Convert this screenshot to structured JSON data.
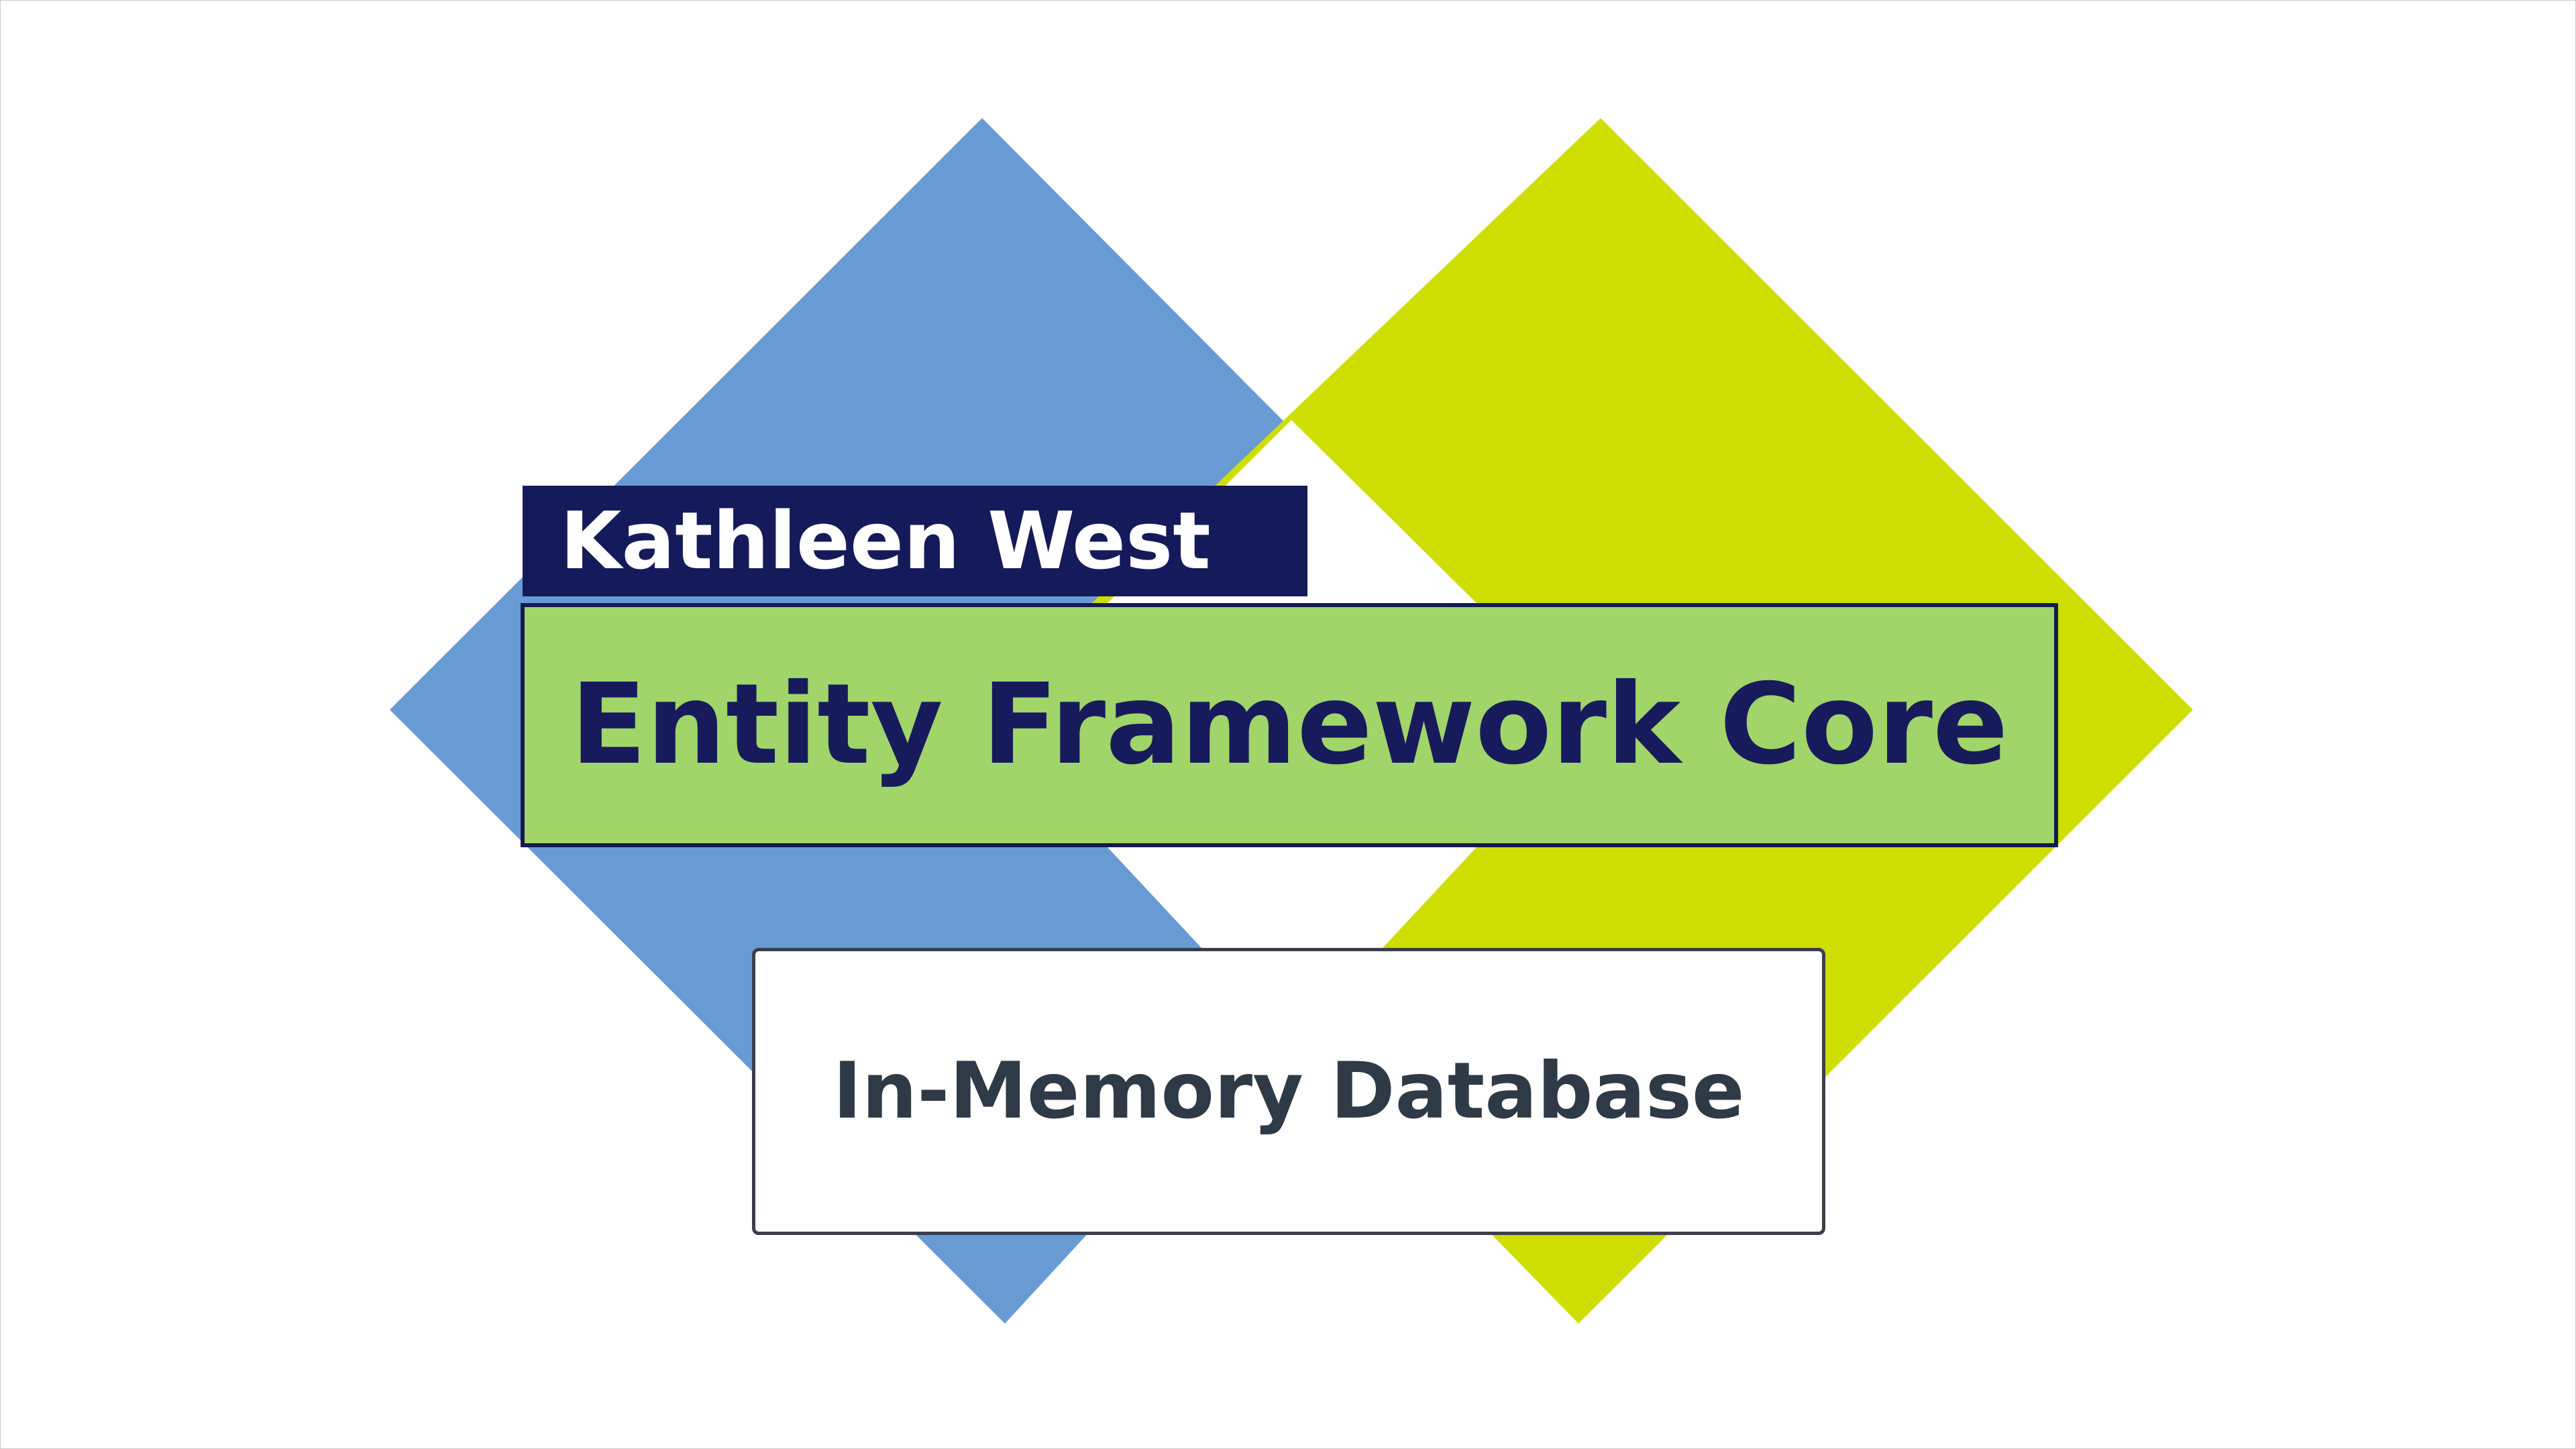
{
  "slide": {
    "author": "Kathleen West",
    "title": "Entity Framework Core",
    "subtitle": "In-Memory Database"
  },
  "colors": {
    "blue_diamond": "#689bd4",
    "green_diamond": "#cede00",
    "author_background": "#141a5a",
    "title_background": "#a1d469",
    "title_text": "#171b5c",
    "subtitle_text": "#2e3a46"
  }
}
